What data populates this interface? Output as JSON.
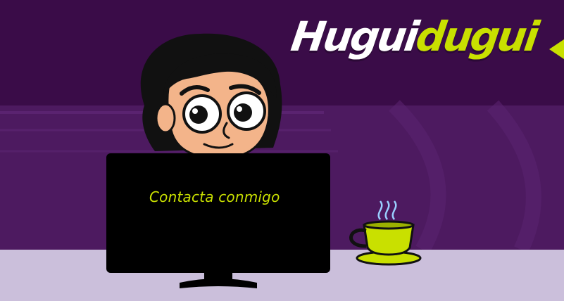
{
  "brand": {
    "name_part_1": "Hugui",
    "name_part_2": "dugui"
  },
  "monitor": {
    "link_label": "Contacta conmigo"
  },
  "colors": {
    "background_dark": "#3b0d4a",
    "band": "#4d1a60",
    "desk": "#cbbfdb",
    "accent": "#c9e000",
    "skin": "#f3b48a"
  },
  "icons": [
    "character-illustration",
    "computer-monitor",
    "coffee-cup-icon",
    "steam-icon",
    "nav-arrow-left-icon"
  ]
}
